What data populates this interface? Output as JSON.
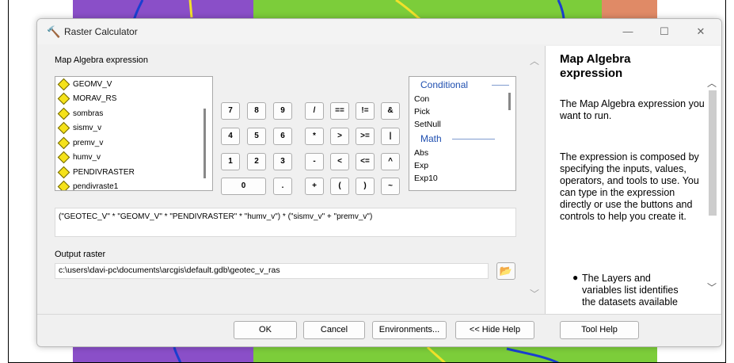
{
  "window": {
    "title": "Raster Calculator",
    "minimize": "—",
    "maximize": "☐",
    "close": "✕"
  },
  "map_algebra": {
    "label": "Map Algebra expression",
    "layers": [
      "GEOMV_V",
      "MORAV_RS",
      "sombras",
      "sismv_v",
      "premv_v",
      "humv_v",
      "PENDIVRASTER",
      "pendivraste1"
    ],
    "buttons": [
      [
        "7",
        "8",
        "9",
        "/",
        "==",
        "!=",
        "&"
      ],
      [
        "4",
        "5",
        "6",
        "*",
        ">",
        ">=",
        "|"
      ],
      [
        "1",
        "2",
        "3",
        "-",
        "<",
        "<=",
        "^"
      ],
      [
        "0",
        ".",
        "+",
        "(",
        ")",
        "~"
      ]
    ],
    "tools": {
      "conditional_label": "Conditional",
      "conditional_items": [
        "Con",
        "Pick",
        "SetNull"
      ],
      "math_label": "Math",
      "math_items": [
        "Abs",
        "Exp",
        "Exp10"
      ]
    },
    "expression": "(\"GEOTEC_V\" * \"GEOMV_V\" * \"PENDIVRASTER\" * \"humv_v\") * (\"sismv_v\" + \"premv_v\")"
  },
  "output": {
    "label": "Output raster",
    "value": "c:\\users\\davi-pc\\documents\\arcgis\\default.gdb\\geotec_v_ras"
  },
  "help": {
    "title": "Map Algebra expression",
    "p1": "The Map Algebra expression you want to run.",
    "p2": "The expression is composed by specifying the inputs, values, operators, and tools to use. You can type in the expression directly or use the buttons and controls to help you create it.",
    "bullet": "The Layers and variables list identifies the datasets available"
  },
  "footer": {
    "ok": "OK",
    "cancel": "Cancel",
    "environments": "Environments...",
    "hide_help": "<< Hide Help",
    "tool_help": "Tool Help"
  },
  "colors": {
    "diamond": "#f5e21a",
    "category": "#1f4fb0",
    "map_purple": "#8a4fc8",
    "map_green": "#7ccd3a"
  }
}
